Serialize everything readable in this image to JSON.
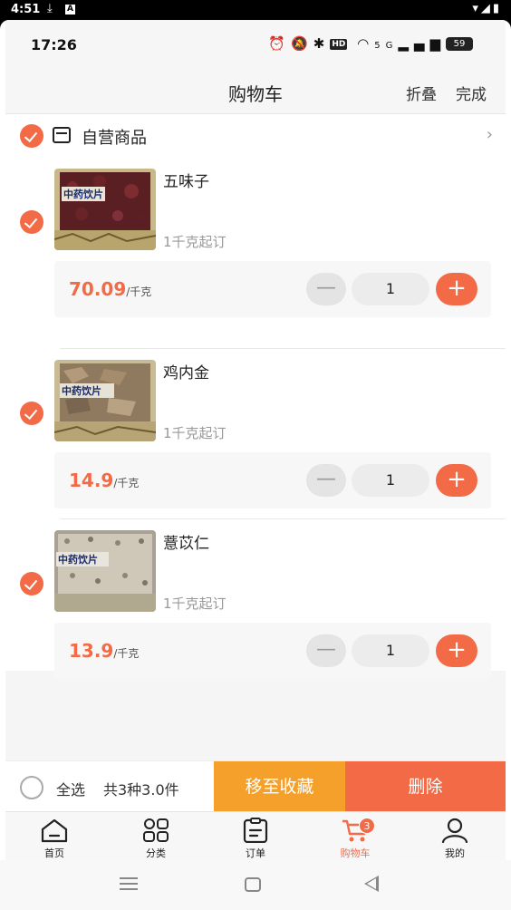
{
  "os_status": {
    "time": "4:51"
  },
  "inner_status": {
    "time": "17:26",
    "battery": "59",
    "network": "5G"
  },
  "navbar": {
    "title": "购物车",
    "fold_label": "折叠",
    "done_label": "完成"
  },
  "shop": {
    "name": "自营商品"
  },
  "items": [
    {
      "name": "五味子",
      "moq": "1千克起订",
      "price": "70.09",
      "unit": "/千克",
      "qty": "1"
    },
    {
      "name": "鸡内金",
      "moq": "1千克起订",
      "price": "14.9",
      "unit": "/千克",
      "qty": "1"
    },
    {
      "name": "薏苡仁",
      "moq": "1千克起订",
      "price": "13.9",
      "unit": "/千克",
      "qty": "1"
    }
  ],
  "action_bar": {
    "select_all": "全选",
    "summary": "共3种3.0件",
    "move_fav": "移至收藏",
    "delete": "删除"
  },
  "tabs": [
    {
      "label": "首页",
      "icon": "home-icon"
    },
    {
      "label": "分类",
      "icon": "category-icon"
    },
    {
      "label": "订单",
      "icon": "order-icon"
    },
    {
      "label": "购物车",
      "icon": "cart-icon",
      "badge": "3",
      "active": true
    },
    {
      "label": "我的",
      "icon": "profile-icon"
    }
  ],
  "colors": {
    "accent": "#f26b46",
    "secondary": "#f5a02a"
  }
}
